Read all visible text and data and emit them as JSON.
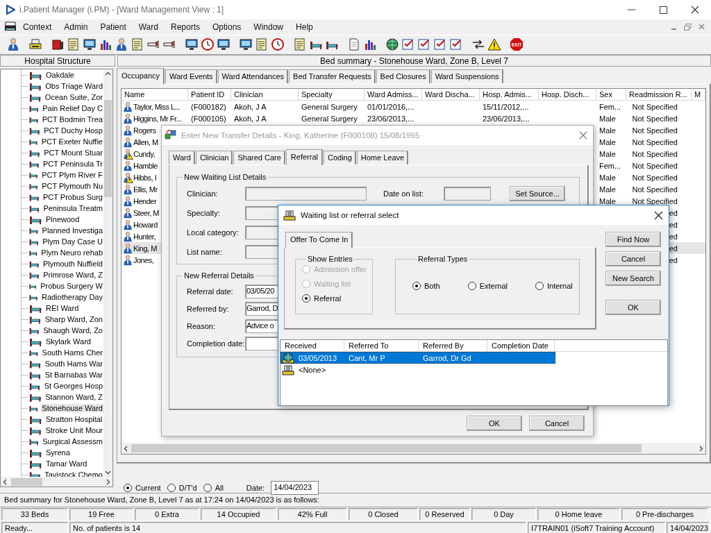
{
  "window": {
    "title": "i.Patient Manager (i.PM) - [Ward Management View : 1]"
  },
  "menu": [
    "Context",
    "Admin",
    "Patient",
    "Ward",
    "Reports",
    "Options",
    "Window",
    "Help"
  ],
  "toolbar": {
    "exit_label": "EXIT"
  },
  "panel_headers": {
    "left": "Hospital Structure",
    "right": "Bed summary - Stonehouse Ward, Zone B, Level 7"
  },
  "tree": {
    "items": [
      {
        "label": "Oakdale",
        "selected": false
      },
      {
        "label": "Obs Triage Ward",
        "selected": false
      },
      {
        "label": "Ocean Suite, Zor",
        "selected": false
      },
      {
        "label": "Pain Relief Day C",
        "selected": false
      },
      {
        "label": "PCT Bodmin Trea",
        "selected": false
      },
      {
        "label": "PCT Duchy Hosp",
        "selected": false
      },
      {
        "label": "PCT Exeter Nuffie",
        "selected": false
      },
      {
        "label": "PCT Mount Stuar",
        "selected": false
      },
      {
        "label": "PCT Peninsula Tr",
        "selected": false
      },
      {
        "label": "PCT Plym River F",
        "selected": false
      },
      {
        "label": "PCT Plymouth Nu",
        "selected": false
      },
      {
        "label": "PCT Probus Surg",
        "selected": false
      },
      {
        "label": "Peninsula Treatm",
        "selected": false
      },
      {
        "label": "Pinewood",
        "selected": false
      },
      {
        "label": "Planned Investiga",
        "selected": false
      },
      {
        "label": "Plym Day Case U",
        "selected": false
      },
      {
        "label": "Plym Neuro rehab",
        "selected": false
      },
      {
        "label": "Plymouth Nuffield",
        "selected": false
      },
      {
        "label": "Primrose Ward, Z",
        "selected": false
      },
      {
        "label": "Probus Surgery W",
        "selected": false
      },
      {
        "label": "Radiotherapy Day",
        "selected": false
      },
      {
        "label": "REI Ward",
        "selected": false
      },
      {
        "label": "Sharp Ward, Zon",
        "selected": false
      },
      {
        "label": "Shaugh Ward, Zo",
        "selected": false
      },
      {
        "label": "Skylark Ward",
        "selected": false
      },
      {
        "label": "South Hams Cher",
        "selected": false
      },
      {
        "label": "South Hams War",
        "selected": false
      },
      {
        "label": "St Barnabas War",
        "selected": false
      },
      {
        "label": "St Georges Hosp",
        "selected": false
      },
      {
        "label": "Stannon Ward, Z",
        "selected": false
      },
      {
        "label": "Stonehouse Ward",
        "selected": true
      },
      {
        "label": "Stratton Hospital",
        "selected": false
      },
      {
        "label": "Stroke Unit Mour",
        "selected": false
      },
      {
        "label": "Surgical Assessm",
        "selected": false
      },
      {
        "label": "Syrena",
        "selected": false
      },
      {
        "label": "Tamar Ward",
        "selected": false
      },
      {
        "label": "Tavistock Chemo",
        "selected": false
      }
    ]
  },
  "tabs": [
    {
      "label": "Occupancy",
      "selected": true
    },
    {
      "label": "Ward Events",
      "selected": false
    },
    {
      "label": "Ward Attendances",
      "selected": false
    },
    {
      "label": "Bed Transfer Requests",
      "selected": false
    },
    {
      "label": "Bed Closures",
      "selected": false
    },
    {
      "label": "Ward Suspensions",
      "selected": false
    }
  ],
  "table": {
    "columns": [
      "Name",
      "Patient ID",
      "Clinician",
      "Specialty",
      "Ward Admiss...",
      "Ward Discha...",
      "Hosp. Admis...",
      "Hosp. Disch...",
      "Sex",
      "Readmission R...",
      "M"
    ],
    "rows": [
      {
        "alert": false,
        "selected": false,
        "name": "Taylor, Miss L...",
        "patient_id": "(F000182)",
        "clinician": "Akoh, J A",
        "specialty": "General Surgery",
        "ward_admission": "01/01/2016,...",
        "hosp_admission": "15/11/2012,...",
        "sex": "Fem...",
        "readmission": "Not Specified"
      },
      {
        "alert": false,
        "selected": false,
        "name": "Higgins, Mr Fr...",
        "patient_id": "(F000105)",
        "clinician": "Akoh, J A",
        "specialty": "General Surgery",
        "ward_admission": "23/06/2013,...",
        "hosp_admission": "23/06/2013,...",
        "sex": "Male",
        "readmission": "Not Specified"
      },
      {
        "alert": false,
        "selected": false,
        "name": "Rogers",
        "sex": "Male",
        "readmission": "Not Specified"
      },
      {
        "alert": false,
        "selected": false,
        "name": "Allen, M",
        "sex": "Male",
        "readmission": "Not Specified"
      },
      {
        "alert": true,
        "selected": false,
        "name": "Cundy,",
        "sex": "Male",
        "readmission": "Not Specified"
      },
      {
        "alert": false,
        "selected": false,
        "name": "Hamble",
        "sex": "Fem...",
        "readmission": "Not Specified"
      },
      {
        "alert": true,
        "selected": false,
        "name": "Hibbs, I",
        "sex": "Male",
        "readmission": "Not Specified"
      },
      {
        "alert": false,
        "selected": false,
        "name": "Ellis, Mr",
        "sex": "Male",
        "readmission": "Not Specified"
      },
      {
        "alert": false,
        "selected": false,
        "name": "Hender",
        "sex": "Male",
        "readmission": "Not Specified"
      },
      {
        "alert": false,
        "selected": false,
        "name": "Steer, M",
        "readmission": "ed"
      },
      {
        "alert": false,
        "selected": false,
        "name": "Howard",
        "readmission": "ed"
      },
      {
        "alert": false,
        "selected": false,
        "name": "Hunter,",
        "readmission": "ed"
      },
      {
        "alert": false,
        "selected": true,
        "name": "King, M",
        "readmission": "ed"
      },
      {
        "alert": false,
        "selected": false,
        "name": "Jones,",
        "readmission": "ed"
      }
    ]
  },
  "view_filter": {
    "options": [
      {
        "label": "Current",
        "selected": true
      },
      {
        "label": "D/T'd",
        "selected": false
      },
      {
        "label": "All",
        "selected": false
      }
    ],
    "date_label": "Date:",
    "date": "14/04/2023"
  },
  "summary": "Bed summary for Stonehouse Ward, Zone B, Level 7 as at 17:24 on 14/04/2023 is as follows:",
  "stats": [
    "33 Beds",
    "19 Free",
    "0 Extra",
    "14 Occupied",
    "42% Full",
    "0 Closed",
    "0 Reserved",
    "0 Day",
    "0 Home leave",
    "0 Pre-discharges"
  ],
  "status_bar": [
    "Ready...",
    "No. of patients is 14",
    "I7TRAIN01 (iSoft7 Training Account)",
    "14/04/2023"
  ],
  "transfer_dialog": {
    "title": "Enter New Transfer Details - King, Katherine (F000108) 15/08/1955",
    "tabs": [
      {
        "label": "Ward",
        "selected": false
      },
      {
        "label": "Clinician",
        "selected": false
      },
      {
        "label": "Shared Care",
        "selected": false
      },
      {
        "label": "Referral",
        "selected": true
      },
      {
        "label": "Coding",
        "selected": false
      },
      {
        "label": "Home Leave",
        "selected": false
      }
    ],
    "waiting_list": {
      "title": "New Waiting List Details",
      "fields": [
        {
          "label": "Clinician:"
        },
        {
          "label": "Specialty:"
        },
        {
          "label": "Local category:"
        },
        {
          "label": "List name:"
        }
      ],
      "date_label": "Date on list:",
      "source_button": "Set Source..."
    },
    "referral": {
      "title": "New Referral Details",
      "fields": [
        {
          "label": "Referral date:",
          "value": "03/05/20"
        },
        {
          "label": "Referred by:",
          "value": "Garrod, D"
        },
        {
          "label": "Reason:",
          "value": "Advice o"
        },
        {
          "label": "Completion date:"
        }
      ]
    },
    "buttons": [
      "OK",
      "Cancel"
    ]
  },
  "select_dialog": {
    "title": "Waiting list or referral select",
    "tabs": [
      {
        "label": "Offer To Come In",
        "selected": true
      }
    ],
    "show_entries": {
      "title": "Show Entries",
      "options": [
        {
          "label": "Admission offer",
          "selected": false,
          "disabled": true
        },
        {
          "label": "Waiting list",
          "selected": false,
          "disabled": true
        },
        {
          "label": "Referral",
          "selected": true,
          "disabled": false
        }
      ]
    },
    "referral_types": {
      "title": "Referral Types",
      "options": [
        {
          "label": "Both",
          "selected": true,
          "disabled": false
        },
        {
          "label": "External",
          "selected": false,
          "disabled": false
        },
        {
          "label": "Internal",
          "selected": false,
          "disabled": false
        }
      ]
    },
    "buttons": [
      "Find Now",
      "Cancel",
      "New Search",
      "OK"
    ],
    "list": {
      "columns": [
        "Received",
        "Referred To",
        "Referred By",
        "Completion Date"
      ],
      "rows": [
        {
          "kind": "referral",
          "selected": true,
          "received": "03/05/2013",
          "referred_to": "Cant, Mr P",
          "referred_by": "Garrod, Dr Gd"
        },
        {
          "kind": "none",
          "selected": false,
          "received": "<None>"
        }
      ]
    }
  }
}
